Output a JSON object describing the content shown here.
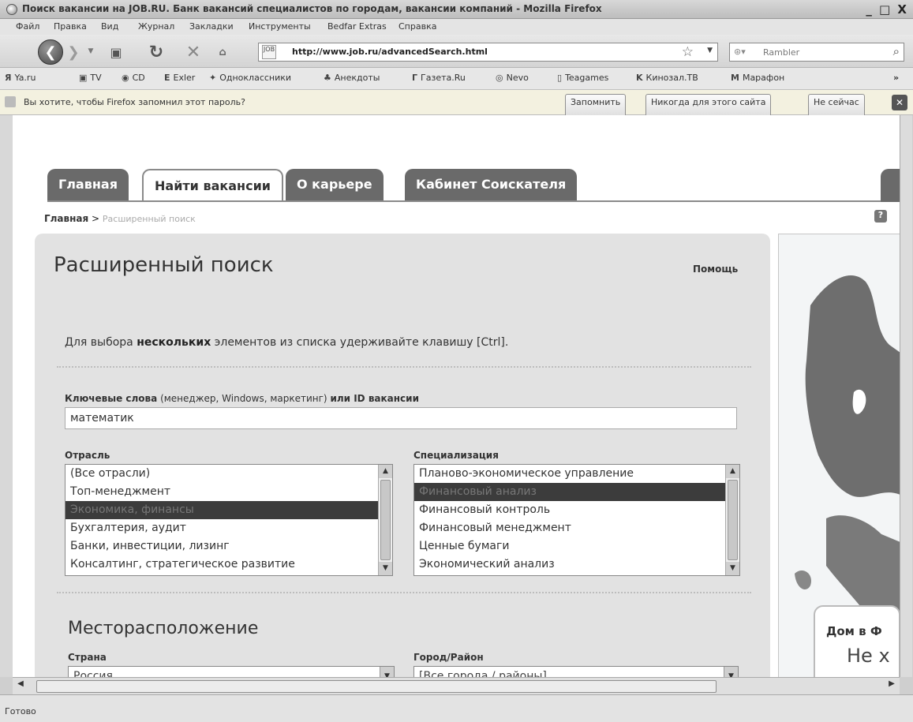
{
  "window": {
    "title": "Поиск вакансии на JOB.RU. Банк вакансий специалистов по городам, вакансии компаний - Mozilla Firefox",
    "controls": "_ □ X"
  },
  "menu": [
    "Файл",
    "Правка",
    "Вид",
    "Журнал",
    "Закладки",
    "Инструменты",
    "Bedfar Extras",
    "Справка"
  ],
  "nav": {
    "url": "http://www.job.ru/advancedSearch.html",
    "favicon_text": "JOB",
    "search_placeholder": "Rambler"
  },
  "bookmarks": [
    {
      "icon": "Я",
      "label": "Ya.ru"
    },
    {
      "icon": "▣",
      "label": "TV"
    },
    {
      "icon": "◉",
      "label": "CD"
    },
    {
      "icon": "E",
      "label": "Exler"
    },
    {
      "icon": "✦",
      "label": "Одноклассники"
    },
    {
      "icon": "♣",
      "label": "Анекдоты"
    },
    {
      "icon": "Г",
      "label": "Газета.Ru"
    },
    {
      "icon": "◎",
      "label": "Nevo"
    },
    {
      "icon": "▯",
      "label": "Teagames"
    },
    {
      "icon": "K",
      "label": "Кинозал.ТВ"
    },
    {
      "icon": "M",
      "label": "Марафон"
    }
  ],
  "bookmarks_more": "»",
  "notification": {
    "message": "Вы хотите, чтобы Firefox запомнил этот пароль?",
    "remember": "Запомнить",
    "never": "Никогда для этого сайта",
    "not_now": "Не сейчас",
    "close": "✕"
  },
  "tabs": [
    "Главная",
    "Найти вакансии",
    "О карьере",
    "Кабинет Соискателя"
  ],
  "breadcrumb": {
    "home": "Главная",
    "sep": " > ",
    "current": "Расширенный поиск"
  },
  "page": {
    "title": "Расширенный поиск",
    "help": "Помощь",
    "hint_prefix": "Для выбора ",
    "hint_bold": "нескольких",
    "hint_suffix": " элементов из списка удерживайте клавишу [Ctrl].",
    "keywords_label": "Ключевые слова",
    "keywords_note": " (менеджер, Windows, маркетинг) ",
    "keywords_label_tail": "или ID вакансии",
    "keywords_value": "математик",
    "industry_label": "Отрасль",
    "industry_items": [
      "(Все отрасли)",
      "Топ-менеджмент",
      "Экономика, финансы",
      "Бухгалтерия, аудит",
      "Банки, инвестиции, лизинг",
      "Консалтинг, стратегическое развитие"
    ],
    "industry_selected": 2,
    "spec_label": "Специализация",
    "spec_items": [
      "Планово-экономическое управление",
      "Финансовый анализ",
      "Финансовый контроль",
      "Финансовый менеджмент",
      "Ценные бумаги",
      "Экономический анализ"
    ],
    "spec_selected": 1,
    "location_title": "Месторасположение",
    "country_label": "Страна",
    "country_value": "Россия",
    "city_label": "Город/Район",
    "city_value": "[Все города / районы]"
  },
  "ad": {
    "line1": "Дом в Ф",
    "line2": "Не х"
  },
  "status": "Готово",
  "colors": {
    "tab_inactive": "#6a6a6a",
    "selection": "#3c3c3c",
    "panel": "#e2e2e2"
  }
}
